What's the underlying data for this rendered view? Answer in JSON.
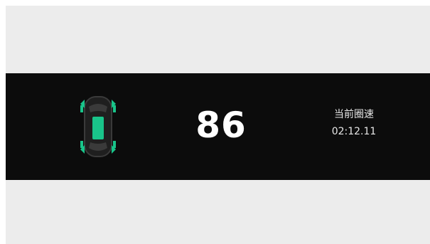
{
  "hud": {
    "speed": "86",
    "lap_label": "当前圈速",
    "lap_time": "02:12.11"
  },
  "car_indicator": {
    "icon": "car-top-view-icon",
    "accent_color": "#19c48a",
    "body_color": "#2a2a2a"
  },
  "colors": {
    "strip_background": "#0c0c0c",
    "screen_background": "#ececec",
    "text": "#ffffff"
  }
}
